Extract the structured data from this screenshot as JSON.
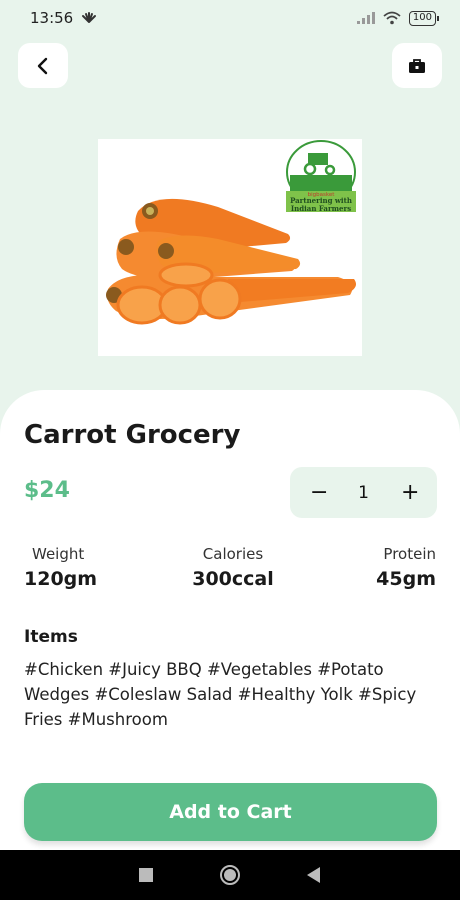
{
  "status_bar": {
    "time": "13:56",
    "battery": "100"
  },
  "icons": {
    "back": "chevron-left-icon",
    "bag": "shopping-bag-icon"
  },
  "product": {
    "image_alt": "Carrots",
    "badge_brand": "bigbasket",
    "badge_line1": "Partnering with",
    "badge_line2": "Indian Farmers",
    "title": "Carrot Grocery",
    "price": "$24"
  },
  "stepper": {
    "minus": "−",
    "quantity": "1",
    "plus": "+"
  },
  "nutrition": {
    "weight": {
      "label": "Weight",
      "value": "120gm"
    },
    "calories": {
      "label": "Calories",
      "value": "300ccal"
    },
    "protein": {
      "label": "Protein",
      "value": "45gm"
    }
  },
  "items": {
    "heading": "Items",
    "text": "#Chicken #Juicy BBQ #Vegetables #Potato Wedges #Coleslaw Salad #Healthy Yolk #Spicy Fries #Mushroom"
  },
  "cart_button": "Add to Cart",
  "colors": {
    "accent": "#5cbd8a",
    "background": "#e8f4ec"
  }
}
